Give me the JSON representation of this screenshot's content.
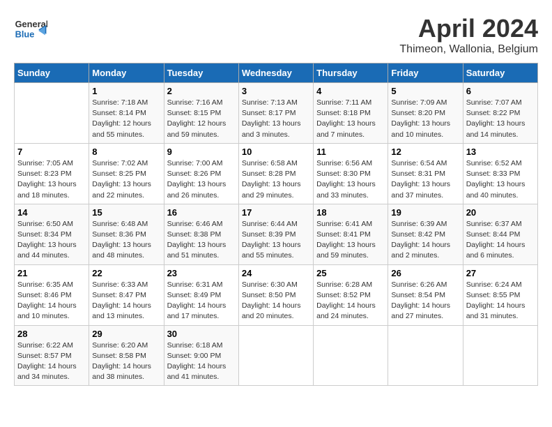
{
  "header": {
    "logo_general": "General",
    "logo_blue": "Blue",
    "month": "April 2024",
    "location": "Thimeon, Wallonia, Belgium"
  },
  "weekdays": [
    "Sunday",
    "Monday",
    "Tuesday",
    "Wednesday",
    "Thursday",
    "Friday",
    "Saturday"
  ],
  "weeks": [
    [
      {
        "day": "",
        "info": ""
      },
      {
        "day": "1",
        "info": "Sunrise: 7:18 AM\nSunset: 8:14 PM\nDaylight: 12 hours\nand 55 minutes."
      },
      {
        "day": "2",
        "info": "Sunrise: 7:16 AM\nSunset: 8:15 PM\nDaylight: 12 hours\nand 59 minutes."
      },
      {
        "day": "3",
        "info": "Sunrise: 7:13 AM\nSunset: 8:17 PM\nDaylight: 13 hours\nand 3 minutes."
      },
      {
        "day": "4",
        "info": "Sunrise: 7:11 AM\nSunset: 8:18 PM\nDaylight: 13 hours\nand 7 minutes."
      },
      {
        "day": "5",
        "info": "Sunrise: 7:09 AM\nSunset: 8:20 PM\nDaylight: 13 hours\nand 10 minutes."
      },
      {
        "day": "6",
        "info": "Sunrise: 7:07 AM\nSunset: 8:22 PM\nDaylight: 13 hours\nand 14 minutes."
      }
    ],
    [
      {
        "day": "7",
        "info": "Sunrise: 7:05 AM\nSunset: 8:23 PM\nDaylight: 13 hours\nand 18 minutes."
      },
      {
        "day": "8",
        "info": "Sunrise: 7:02 AM\nSunset: 8:25 PM\nDaylight: 13 hours\nand 22 minutes."
      },
      {
        "day": "9",
        "info": "Sunrise: 7:00 AM\nSunset: 8:26 PM\nDaylight: 13 hours\nand 26 minutes."
      },
      {
        "day": "10",
        "info": "Sunrise: 6:58 AM\nSunset: 8:28 PM\nDaylight: 13 hours\nand 29 minutes."
      },
      {
        "day": "11",
        "info": "Sunrise: 6:56 AM\nSunset: 8:30 PM\nDaylight: 13 hours\nand 33 minutes."
      },
      {
        "day": "12",
        "info": "Sunrise: 6:54 AM\nSunset: 8:31 PM\nDaylight: 13 hours\nand 37 minutes."
      },
      {
        "day": "13",
        "info": "Sunrise: 6:52 AM\nSunset: 8:33 PM\nDaylight: 13 hours\nand 40 minutes."
      }
    ],
    [
      {
        "day": "14",
        "info": "Sunrise: 6:50 AM\nSunset: 8:34 PM\nDaylight: 13 hours\nand 44 minutes."
      },
      {
        "day": "15",
        "info": "Sunrise: 6:48 AM\nSunset: 8:36 PM\nDaylight: 13 hours\nand 48 minutes."
      },
      {
        "day": "16",
        "info": "Sunrise: 6:46 AM\nSunset: 8:38 PM\nDaylight: 13 hours\nand 51 minutes."
      },
      {
        "day": "17",
        "info": "Sunrise: 6:44 AM\nSunset: 8:39 PM\nDaylight: 13 hours\nand 55 minutes."
      },
      {
        "day": "18",
        "info": "Sunrise: 6:41 AM\nSunset: 8:41 PM\nDaylight: 13 hours\nand 59 minutes."
      },
      {
        "day": "19",
        "info": "Sunrise: 6:39 AM\nSunset: 8:42 PM\nDaylight: 14 hours\nand 2 minutes."
      },
      {
        "day": "20",
        "info": "Sunrise: 6:37 AM\nSunset: 8:44 PM\nDaylight: 14 hours\nand 6 minutes."
      }
    ],
    [
      {
        "day": "21",
        "info": "Sunrise: 6:35 AM\nSunset: 8:46 PM\nDaylight: 14 hours\nand 10 minutes."
      },
      {
        "day": "22",
        "info": "Sunrise: 6:33 AM\nSunset: 8:47 PM\nDaylight: 14 hours\nand 13 minutes."
      },
      {
        "day": "23",
        "info": "Sunrise: 6:31 AM\nSunset: 8:49 PM\nDaylight: 14 hours\nand 17 minutes."
      },
      {
        "day": "24",
        "info": "Sunrise: 6:30 AM\nSunset: 8:50 PM\nDaylight: 14 hours\nand 20 minutes."
      },
      {
        "day": "25",
        "info": "Sunrise: 6:28 AM\nSunset: 8:52 PM\nDaylight: 14 hours\nand 24 minutes."
      },
      {
        "day": "26",
        "info": "Sunrise: 6:26 AM\nSunset: 8:54 PM\nDaylight: 14 hours\nand 27 minutes."
      },
      {
        "day": "27",
        "info": "Sunrise: 6:24 AM\nSunset: 8:55 PM\nDaylight: 14 hours\nand 31 minutes."
      }
    ],
    [
      {
        "day": "28",
        "info": "Sunrise: 6:22 AM\nSunset: 8:57 PM\nDaylight: 14 hours\nand 34 minutes."
      },
      {
        "day": "29",
        "info": "Sunrise: 6:20 AM\nSunset: 8:58 PM\nDaylight: 14 hours\nand 38 minutes."
      },
      {
        "day": "30",
        "info": "Sunrise: 6:18 AM\nSunset: 9:00 PM\nDaylight: 14 hours\nand 41 minutes."
      },
      {
        "day": "",
        "info": ""
      },
      {
        "day": "",
        "info": ""
      },
      {
        "day": "",
        "info": ""
      },
      {
        "day": "",
        "info": ""
      }
    ]
  ]
}
